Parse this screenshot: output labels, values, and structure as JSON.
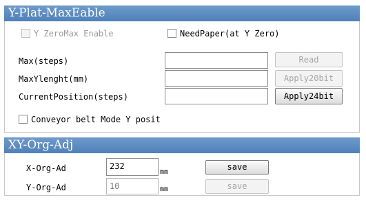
{
  "yplat": {
    "title": "Y-Plat-MaxEable",
    "zeromax_label": "Y ZeroMax Enable",
    "needpaper_label": "NeedPaper(at Y Zero)",
    "max_label": "Max(steps)",
    "maxylenght_label": "MaxYlenght(mm)",
    "currentpos_label": "CurrentPosition(steps)",
    "read_button": "Read",
    "apply20_button": "Apply20bit",
    "apply24_button": "Apply24bit",
    "conveyor_label": "Conveyor belt Mode Y posit"
  },
  "xyorg": {
    "title": "XY-Org-Adj",
    "x_label": "X-Org-Ad",
    "x_value": "232",
    "x_unit": "mm",
    "x_save": "save",
    "y_label": "Y-Org-Ad",
    "y_value": "10",
    "y_unit": "mm",
    "y_save": "save"
  }
}
